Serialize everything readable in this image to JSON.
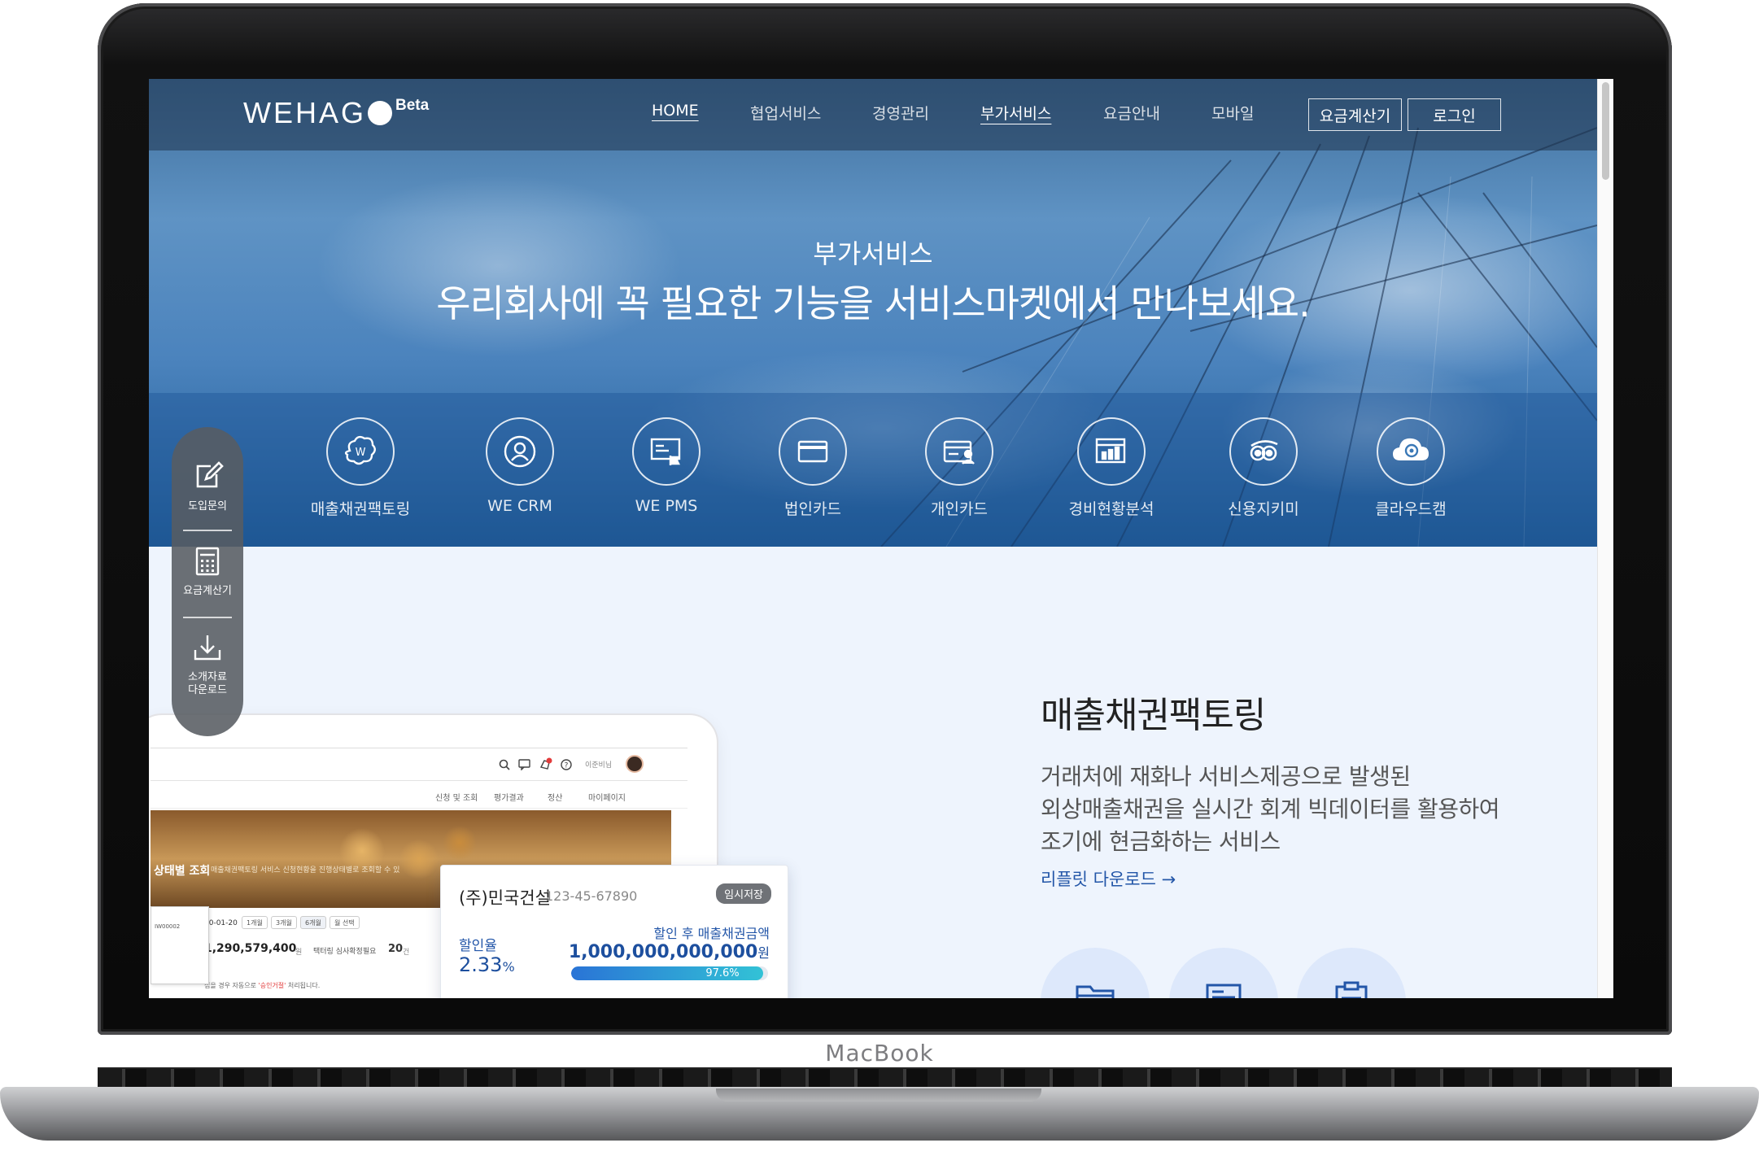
{
  "device": {
    "brand": "MacBook"
  },
  "nav": {
    "logo_text": "WEHAG",
    "logo_beta": "Beta",
    "items": [
      {
        "label": "HOME",
        "active": true
      },
      {
        "label": "협업서비스",
        "active": false
      },
      {
        "label": "경영관리",
        "active": false
      },
      {
        "label": "부가서비스",
        "active": true
      },
      {
        "label": "요금안내",
        "active": false
      },
      {
        "label": "모바일",
        "active": false
      }
    ],
    "buttons": [
      {
        "label": "요금계산기"
      },
      {
        "label": "로그인"
      }
    ]
  },
  "hero": {
    "subtitle": "부가서비스",
    "title": "우리회사에 꼭 필요한 기능을 서비스마켓에서 만나보세요."
  },
  "services": [
    {
      "label": "매출채권팩토링",
      "icon": "factoring-icon"
    },
    {
      "label": "WE CRM",
      "icon": "crm-icon"
    },
    {
      "label": "WE PMS",
      "icon": "pms-icon"
    },
    {
      "label": "법인카드",
      "icon": "corporate-card-icon"
    },
    {
      "label": "개인카드",
      "icon": "personal-card-icon"
    },
    {
      "label": "경비현황분석",
      "icon": "expense-chart-icon"
    },
    {
      "label": "신용지키미",
      "icon": "credit-watch-icon"
    },
    {
      "label": "클라우드캠",
      "icon": "cloud-cam-icon"
    }
  ],
  "quick_menu": {
    "items": [
      {
        "label": "도입문의",
        "icon": "edit-icon"
      },
      {
        "label": "요금계산기",
        "icon": "calculator-icon"
      },
      {
        "label": "소개자료\n다운로드",
        "icon": "download-icon"
      }
    ]
  },
  "product": {
    "title": "매출채권팩토링",
    "description_lines": [
      "거래처에 재화나 서비스제공으로 발생된",
      "외상매출채권을 실시간 회계 빅데이터를 활용하여",
      "조기에 현금화하는 서비스"
    ],
    "leaflet_link": "리플릿 다운로드 →"
  },
  "mockup": {
    "user": "이준비님",
    "subnav": [
      "신청 및 조회",
      "평가결과",
      "정산",
      "마이페이지"
    ],
    "banner_title": "상태별 조회",
    "banner_desc": "매출채권팩토링 서비스 신청현황을 진행상태별로 조회할 수 있",
    "date_start": "20-01-20",
    "period_options": [
      "1개월",
      "3개월",
      "6개월",
      "월 선택"
    ],
    "amount": "1,290,579,400",
    "amount_unit": "원",
    "pending_label": "택터링 심사확정필요",
    "pending_count": "20",
    "pending_unit": "건",
    "bottom_note_prefix": "접을 경우 자동으로",
    "bottom_note_highlight": "'승인거절'",
    "bottom_note_suffix": "처리됩니다.",
    "popup_code": "IW00002"
  },
  "calc_card": {
    "company": "(주)민국건설",
    "biz_no": "123-45-67890",
    "badge": "임시저장",
    "rate_label": "할인율",
    "rate_value": "2.33",
    "rate_unit": "%",
    "amount_label": "할인 후 매출채권금액",
    "amount_value": "1,000,000,000,000",
    "amount_unit": "원",
    "progress_value": 97.6,
    "progress_text": "97.6%"
  },
  "feature_icons": [
    "folder-icon",
    "document-list-icon",
    "clipboard-icon"
  ],
  "colors": {
    "accent": "#2356a8",
    "hero_blue": "#4b83bd",
    "page_bg": "#eef4fd",
    "progress_start": "#2a74d6",
    "progress_end": "#32c2d6"
  }
}
